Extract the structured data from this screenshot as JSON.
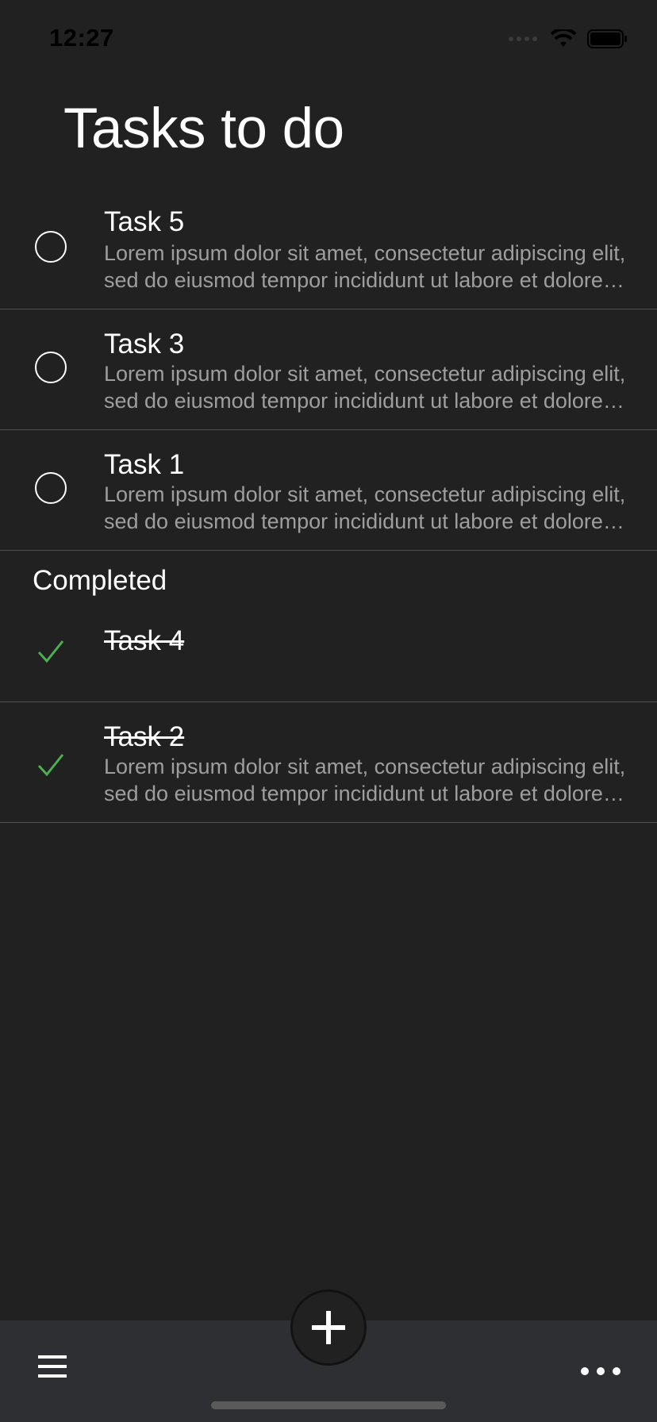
{
  "status_bar": {
    "time": "12:27"
  },
  "page": {
    "title": "Tasks to do"
  },
  "tasks": [
    {
      "title": "Task 5",
      "description": "Lorem ipsum dolor sit amet, consectetur adipiscing elit, sed do eiusmod tempor incididunt ut labore et dolore magna aliqua."
    },
    {
      "title": "Task 3",
      "description": "Lorem ipsum dolor sit amet, consectetur adipiscing elit, sed do eiusmod tempor incididunt ut labore et dolore magna aliqua."
    },
    {
      "title": "Task 1",
      "description": "Lorem ipsum dolor sit amet, consectetur adipiscing elit, sed do eiusmod tempor incididunt ut labore et dolore magna aliqua."
    }
  ],
  "completed": {
    "header": "Completed",
    "tasks": [
      {
        "title": "Task 4"
      },
      {
        "title": "Task 2",
        "description": "Lorem ipsum dolor sit amet, consectetur adipiscing elit, sed do eiusmod tempor incididunt ut labore et dolore magna aliqua."
      }
    ]
  },
  "bottom_bar": {
    "add_icon": "plus-icon",
    "menu_icon": "hamburger-menu-icon",
    "more_icon": "more-dots-icon"
  },
  "colors": {
    "background": "#212121",
    "bottom_bar": "#2e2f33",
    "check_green": "#4caf50",
    "secondary_text": "#9e9e9e",
    "divider": "#4e4e4e"
  }
}
